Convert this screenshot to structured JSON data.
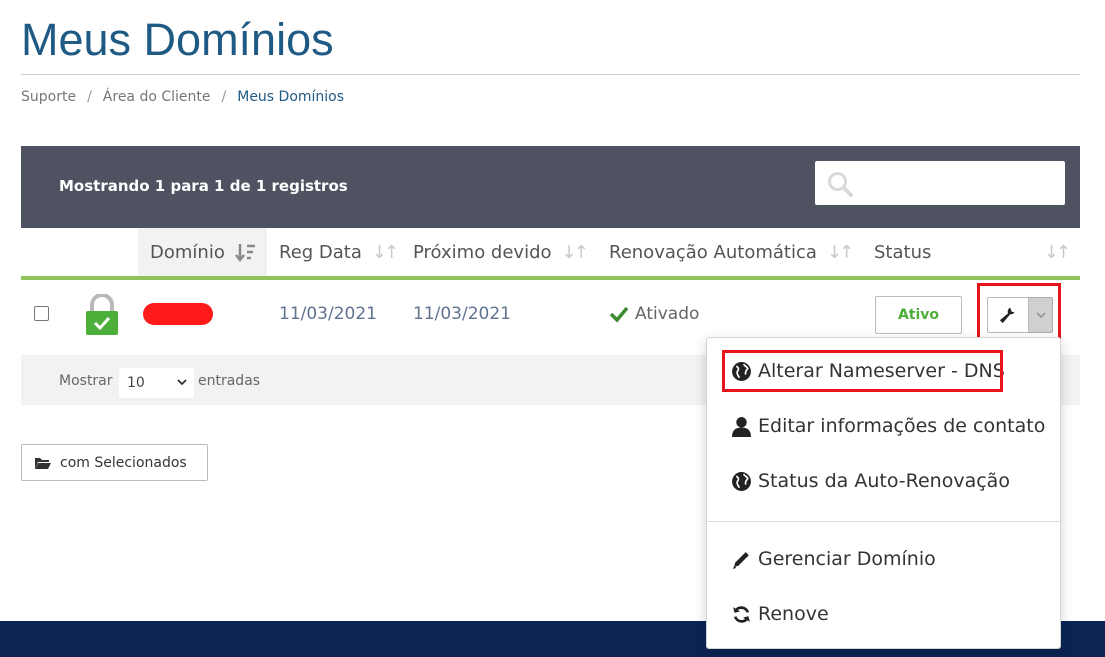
{
  "page": {
    "title": "Meus Domínios"
  },
  "breadcrumb": {
    "items": [
      "Suporte",
      "Área do Cliente",
      "Meus Domínios"
    ],
    "separator": "/"
  },
  "table": {
    "showing_text": "Mostrando 1 para 1 de 1 registros",
    "search": {
      "placeholder": "",
      "value": ""
    },
    "columns": [
      {
        "label": "",
        "sorted": false
      },
      {
        "label": "Domínio",
        "sorted": true
      },
      {
        "label": "Reg Data",
        "sorted": false
      },
      {
        "label": "Próximo devido",
        "sorted": false
      },
      {
        "label": "Renovação Automática",
        "sorted": false
      },
      {
        "label": "Status",
        "sorted": false
      },
      {
        "label": "",
        "sorted": false
      }
    ],
    "rows": [
      {
        "domain": "",
        "domain_redacted": true,
        "reg_date": "11/03/2021",
        "next_due": "11/03/2021",
        "auto_renew": "Ativado",
        "status": "Ativo"
      }
    ],
    "footer": {
      "show_label": "Mostrar",
      "length_value": "10",
      "entries_label": "entradas"
    }
  },
  "with_selected": {
    "label": "com Selecionados"
  },
  "dropdown": {
    "items": [
      {
        "icon": "globe-icon",
        "label": "Alterar Nameserver - DNS"
      },
      {
        "icon": "user-icon",
        "label": "Editar informações de contato"
      },
      {
        "icon": "globe-icon",
        "label": "Status da Auto-Renovação"
      },
      {
        "icon": "pencil-icon",
        "label": "Gerenciar Domínio"
      },
      {
        "icon": "refresh-icon",
        "label": "Renove"
      }
    ]
  },
  "colors": {
    "title": "#1f5a85",
    "header_bar": "#4f5361",
    "accent_green": "#8ec45a",
    "status_green": "#4caf3a",
    "highlight_red": "#e8141c",
    "footer_band": "#0c2454"
  }
}
